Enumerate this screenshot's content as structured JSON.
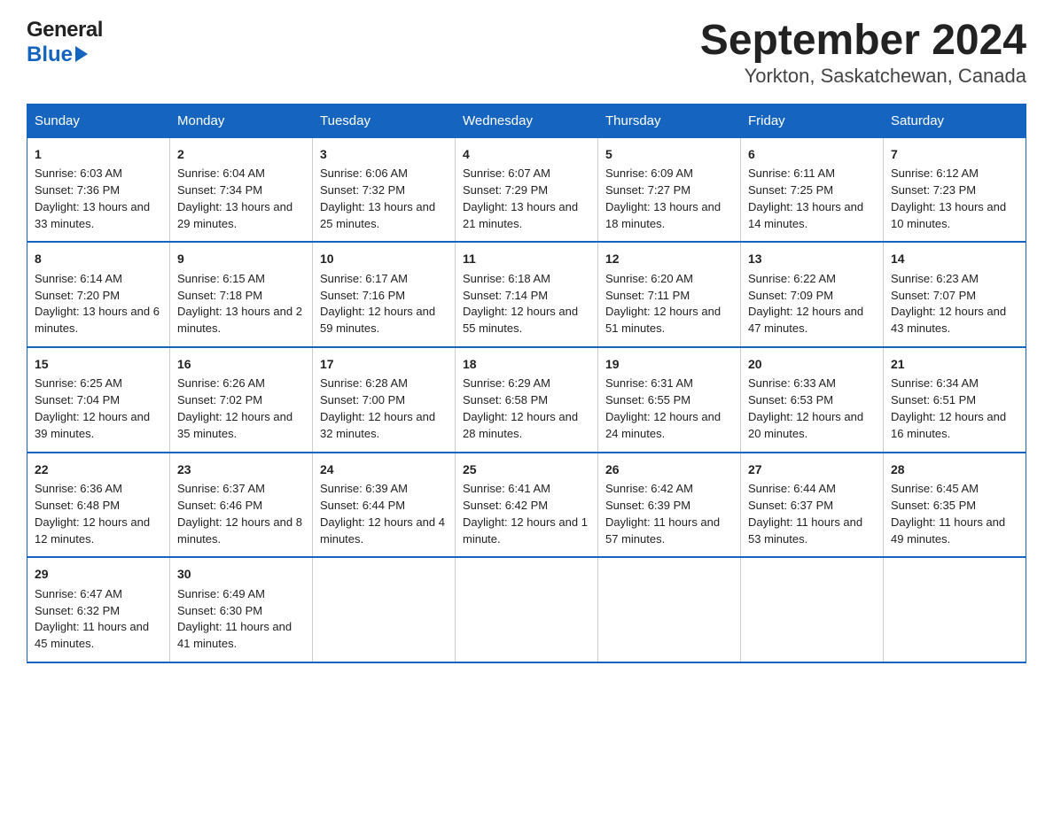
{
  "header": {
    "logo_general": "General",
    "logo_blue": "Blue",
    "title": "September 2024",
    "subtitle": "Yorkton, Saskatchewan, Canada"
  },
  "days_of_week": [
    "Sunday",
    "Monday",
    "Tuesday",
    "Wednesday",
    "Thursday",
    "Friday",
    "Saturday"
  ],
  "weeks": [
    [
      {
        "day": "1",
        "sunrise": "Sunrise: 6:03 AM",
        "sunset": "Sunset: 7:36 PM",
        "daylight": "Daylight: 13 hours and 33 minutes."
      },
      {
        "day": "2",
        "sunrise": "Sunrise: 6:04 AM",
        "sunset": "Sunset: 7:34 PM",
        "daylight": "Daylight: 13 hours and 29 minutes."
      },
      {
        "day": "3",
        "sunrise": "Sunrise: 6:06 AM",
        "sunset": "Sunset: 7:32 PM",
        "daylight": "Daylight: 13 hours and 25 minutes."
      },
      {
        "day": "4",
        "sunrise": "Sunrise: 6:07 AM",
        "sunset": "Sunset: 7:29 PM",
        "daylight": "Daylight: 13 hours and 21 minutes."
      },
      {
        "day": "5",
        "sunrise": "Sunrise: 6:09 AM",
        "sunset": "Sunset: 7:27 PM",
        "daylight": "Daylight: 13 hours and 18 minutes."
      },
      {
        "day": "6",
        "sunrise": "Sunrise: 6:11 AM",
        "sunset": "Sunset: 7:25 PM",
        "daylight": "Daylight: 13 hours and 14 minutes."
      },
      {
        "day": "7",
        "sunrise": "Sunrise: 6:12 AM",
        "sunset": "Sunset: 7:23 PM",
        "daylight": "Daylight: 13 hours and 10 minutes."
      }
    ],
    [
      {
        "day": "8",
        "sunrise": "Sunrise: 6:14 AM",
        "sunset": "Sunset: 7:20 PM",
        "daylight": "Daylight: 13 hours and 6 minutes."
      },
      {
        "day": "9",
        "sunrise": "Sunrise: 6:15 AM",
        "sunset": "Sunset: 7:18 PM",
        "daylight": "Daylight: 13 hours and 2 minutes."
      },
      {
        "day": "10",
        "sunrise": "Sunrise: 6:17 AM",
        "sunset": "Sunset: 7:16 PM",
        "daylight": "Daylight: 12 hours and 59 minutes."
      },
      {
        "day": "11",
        "sunrise": "Sunrise: 6:18 AM",
        "sunset": "Sunset: 7:14 PM",
        "daylight": "Daylight: 12 hours and 55 minutes."
      },
      {
        "day": "12",
        "sunrise": "Sunrise: 6:20 AM",
        "sunset": "Sunset: 7:11 PM",
        "daylight": "Daylight: 12 hours and 51 minutes."
      },
      {
        "day": "13",
        "sunrise": "Sunrise: 6:22 AM",
        "sunset": "Sunset: 7:09 PM",
        "daylight": "Daylight: 12 hours and 47 minutes."
      },
      {
        "day": "14",
        "sunrise": "Sunrise: 6:23 AM",
        "sunset": "Sunset: 7:07 PM",
        "daylight": "Daylight: 12 hours and 43 minutes."
      }
    ],
    [
      {
        "day": "15",
        "sunrise": "Sunrise: 6:25 AM",
        "sunset": "Sunset: 7:04 PM",
        "daylight": "Daylight: 12 hours and 39 minutes."
      },
      {
        "day": "16",
        "sunrise": "Sunrise: 6:26 AM",
        "sunset": "Sunset: 7:02 PM",
        "daylight": "Daylight: 12 hours and 35 minutes."
      },
      {
        "day": "17",
        "sunrise": "Sunrise: 6:28 AM",
        "sunset": "Sunset: 7:00 PM",
        "daylight": "Daylight: 12 hours and 32 minutes."
      },
      {
        "day": "18",
        "sunrise": "Sunrise: 6:29 AM",
        "sunset": "Sunset: 6:58 PM",
        "daylight": "Daylight: 12 hours and 28 minutes."
      },
      {
        "day": "19",
        "sunrise": "Sunrise: 6:31 AM",
        "sunset": "Sunset: 6:55 PM",
        "daylight": "Daylight: 12 hours and 24 minutes."
      },
      {
        "day": "20",
        "sunrise": "Sunrise: 6:33 AM",
        "sunset": "Sunset: 6:53 PM",
        "daylight": "Daylight: 12 hours and 20 minutes."
      },
      {
        "day": "21",
        "sunrise": "Sunrise: 6:34 AM",
        "sunset": "Sunset: 6:51 PM",
        "daylight": "Daylight: 12 hours and 16 minutes."
      }
    ],
    [
      {
        "day": "22",
        "sunrise": "Sunrise: 6:36 AM",
        "sunset": "Sunset: 6:48 PM",
        "daylight": "Daylight: 12 hours and 12 minutes."
      },
      {
        "day": "23",
        "sunrise": "Sunrise: 6:37 AM",
        "sunset": "Sunset: 6:46 PM",
        "daylight": "Daylight: 12 hours and 8 minutes."
      },
      {
        "day": "24",
        "sunrise": "Sunrise: 6:39 AM",
        "sunset": "Sunset: 6:44 PM",
        "daylight": "Daylight: 12 hours and 4 minutes."
      },
      {
        "day": "25",
        "sunrise": "Sunrise: 6:41 AM",
        "sunset": "Sunset: 6:42 PM",
        "daylight": "Daylight: 12 hours and 1 minute."
      },
      {
        "day": "26",
        "sunrise": "Sunrise: 6:42 AM",
        "sunset": "Sunset: 6:39 PM",
        "daylight": "Daylight: 11 hours and 57 minutes."
      },
      {
        "day": "27",
        "sunrise": "Sunrise: 6:44 AM",
        "sunset": "Sunset: 6:37 PM",
        "daylight": "Daylight: 11 hours and 53 minutes."
      },
      {
        "day": "28",
        "sunrise": "Sunrise: 6:45 AM",
        "sunset": "Sunset: 6:35 PM",
        "daylight": "Daylight: 11 hours and 49 minutes."
      }
    ],
    [
      {
        "day": "29",
        "sunrise": "Sunrise: 6:47 AM",
        "sunset": "Sunset: 6:32 PM",
        "daylight": "Daylight: 11 hours and 45 minutes."
      },
      {
        "day": "30",
        "sunrise": "Sunrise: 6:49 AM",
        "sunset": "Sunset: 6:30 PM",
        "daylight": "Daylight: 11 hours and 41 minutes."
      },
      null,
      null,
      null,
      null,
      null
    ]
  ]
}
